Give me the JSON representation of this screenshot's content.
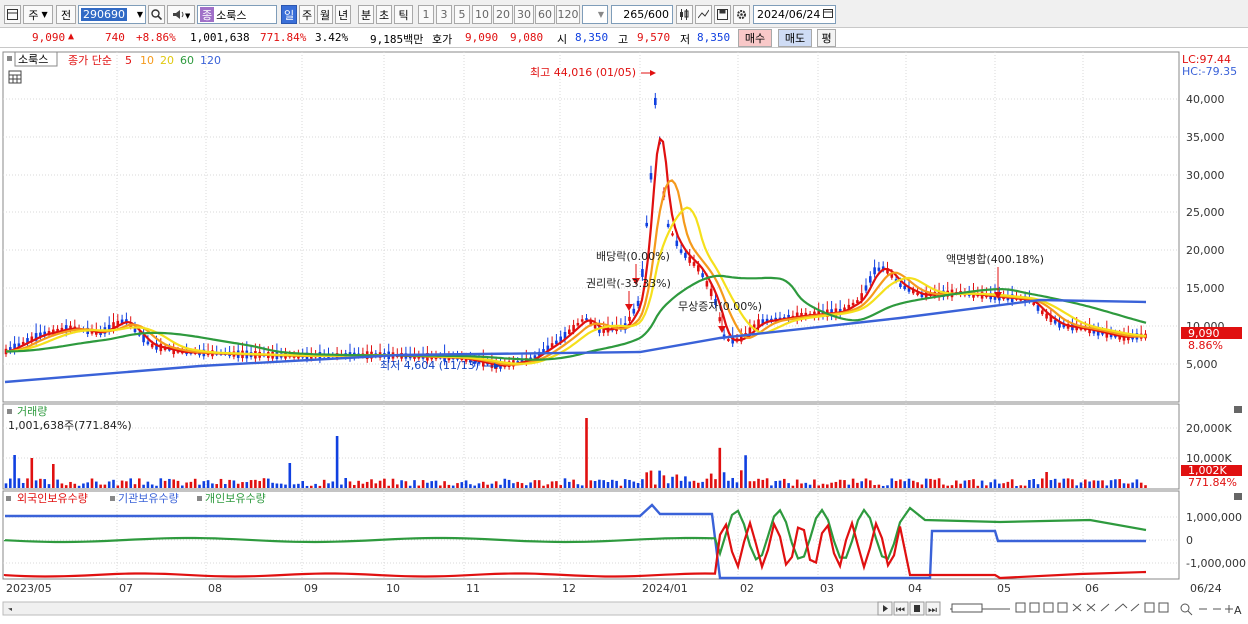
{
  "toolbar": {
    "jusik_label": "주",
    "jeon_label": "전",
    "stock_code": "290690",
    "stock_tag": "종",
    "stock_name": "소룩스",
    "periods": [
      "일",
      "주",
      "월",
      "년",
      "분",
      "초",
      "틱"
    ],
    "active_period": "일",
    "nums": [
      "1",
      "3",
      "5",
      "10",
      "20",
      "30",
      "60",
      "120"
    ],
    "count_value": "265",
    "count_total": "/600",
    "date_value": "2024/06/24"
  },
  "quote": {
    "price": "9,090",
    "arrow": "▲",
    "change": "740",
    "change_pct": "+8.86%",
    "volume": "1,001,638",
    "volume_pct": "771.84%",
    "turnover": "3.42%",
    "amount": "9,185백만",
    "hoga_label": "호가",
    "ask": "9,090",
    "bid": "9,080",
    "open_label": "시",
    "open": "8,350",
    "high_label": "고",
    "high": "9,570",
    "low_label": "저",
    "low": "8,350",
    "buy_label": "매수",
    "sell_label": "매도",
    "pyeong_label": "평"
  },
  "price_panel": {
    "name_tag": "소룩스",
    "ma_title": "종가 단순",
    "ma_periods": [
      "5",
      "10",
      "20",
      "60",
      "120"
    ],
    "ma_colors": [
      "#e01010",
      "#f59a1c",
      "#f5e01c",
      "#2e9a3e",
      "#3a62d8"
    ],
    "lc": "LC:97.44",
    "hc": "HC:-79.35",
    "y_ticks": [
      "40,000",
      "35,000",
      "30,000",
      "25,000",
      "20,000",
      "15,000",
      "10,000",
      "5,000"
    ],
    "last_price_box": "9,090",
    "last_pct": "8.86%",
    "annotations": {
      "high": "최고 44,016 (01/05)",
      "low": "최저 4,604 (11/13)",
      "dividend": "배당락(0.00%)",
      "rights": "권리락(-33.33%)",
      "bonus": "무상증자(0.00%)",
      "split": "액면병합(400.18%)"
    }
  },
  "volume_panel": {
    "title": "거래량",
    "value": "1,001,638주(771.84%)",
    "y_ticks": [
      "20,000K",
      "10,000K"
    ],
    "last_box": "1,002K",
    "last_pct": "771.84%"
  },
  "holdings_panel": {
    "series": [
      "외국인보유수량",
      "기관보유수량",
      "개인보유수량"
    ],
    "series_colors": [
      "#e01010",
      "#3a62d8",
      "#2e9a3e"
    ],
    "y_ticks": [
      "1,000,000",
      "0",
      "-1,000,000"
    ]
  },
  "x_axis": {
    "labels": [
      "2023/05",
      "07",
      "08",
      "09",
      "10",
      "11",
      "12",
      "2024/01",
      "02",
      "03",
      "04",
      "05",
      "06",
      "06/24"
    ]
  }
}
